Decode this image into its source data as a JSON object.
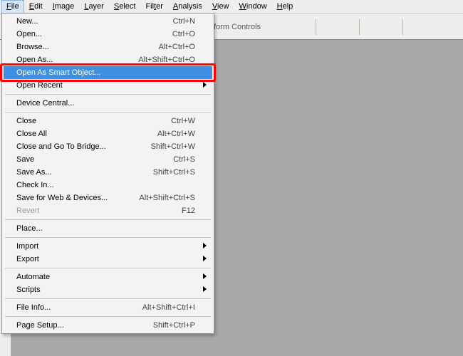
{
  "menubar": {
    "items": [
      {
        "label": "File",
        "underlined": "F",
        "open": true
      },
      {
        "label": "Edit",
        "underlined": "E"
      },
      {
        "label": "Image",
        "underlined": "I"
      },
      {
        "label": "Layer",
        "underlined": "L"
      },
      {
        "label": "Select",
        "underlined": "S"
      },
      {
        "label": "Filter",
        "underlined": "t"
      },
      {
        "label": "Analysis",
        "underlined": "A"
      },
      {
        "label": "View",
        "underlined": "V"
      },
      {
        "label": "Window",
        "underlined": "W"
      },
      {
        "label": "Help",
        "underlined": "H"
      }
    ]
  },
  "options_bar": {
    "label_fragment": "form Controls",
    "icons": [
      "align-top-edges",
      "align-vertical-centers",
      "align-bottom-edges",
      "align-left-edges",
      "align-horizontal-centers",
      "align-right-edges"
    ]
  },
  "file_menu": {
    "groups": [
      [
        {
          "label": "New...",
          "shortcut": "Ctrl+N"
        },
        {
          "label": "Open...",
          "shortcut": "Ctrl+O"
        },
        {
          "label": "Browse...",
          "shortcut": "Alt+Ctrl+O"
        },
        {
          "label": "Open As...",
          "shortcut": "Alt+Shift+Ctrl+O"
        },
        {
          "label": "Open As Smart Object...",
          "shortcut": "",
          "hover": true,
          "highlighted": true
        },
        {
          "label": "Open Recent",
          "shortcut": "",
          "submenu": true
        }
      ],
      [
        {
          "label": "Device Central...",
          "shortcut": ""
        }
      ],
      [
        {
          "label": "Close",
          "shortcut": "Ctrl+W"
        },
        {
          "label": "Close All",
          "shortcut": "Alt+Ctrl+W"
        },
        {
          "label": "Close and Go To Bridge...",
          "shortcut": "Shift+Ctrl+W"
        },
        {
          "label": "Save",
          "shortcut": "Ctrl+S"
        },
        {
          "label": "Save As...",
          "shortcut": "Shift+Ctrl+S"
        },
        {
          "label": "Check In...",
          "shortcut": ""
        },
        {
          "label": "Save for Web & Devices...",
          "shortcut": "Alt+Shift+Ctrl+S"
        },
        {
          "label": "Revert",
          "shortcut": "F12",
          "disabled": true
        }
      ],
      [
        {
          "label": "Place...",
          "shortcut": ""
        }
      ],
      [
        {
          "label": "Import",
          "shortcut": "",
          "submenu": true
        },
        {
          "label": "Export",
          "shortcut": "",
          "submenu": true
        }
      ],
      [
        {
          "label": "Automate",
          "shortcut": "",
          "submenu": true
        },
        {
          "label": "Scripts",
          "shortcut": "",
          "submenu": true
        }
      ],
      [
        {
          "label": "File Info...",
          "shortcut": "Alt+Shift+Ctrl+I"
        }
      ],
      [
        {
          "label": "Page Setup...",
          "shortcut": "Shift+Ctrl+P"
        }
      ]
    ]
  }
}
